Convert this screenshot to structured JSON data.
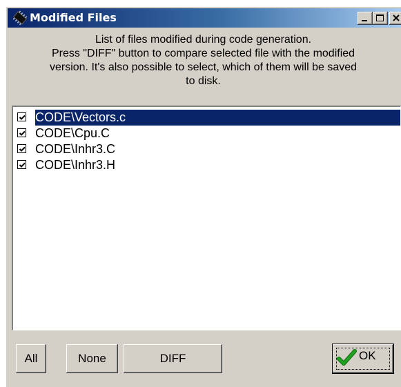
{
  "window": {
    "title": "Modified Files",
    "title_icon": "chip-icon",
    "caption_buttons": [
      "minimize",
      "maximize",
      "close"
    ]
  },
  "description": {
    "lines": [
      "List of files modified during code generation.",
      "Press \"DIFF\" button to compare selected file with the modified",
      "version. It's also possible to select, which of them will be saved",
      "to disk."
    ]
  },
  "files": {
    "items": [
      {
        "label": "CODE\\Vectors.c",
        "checked": true,
        "selected": true
      },
      {
        "label": "CODE\\Cpu.C",
        "checked": true,
        "selected": false
      },
      {
        "label": "CODE\\Inhr3.C",
        "checked": true,
        "selected": false
      },
      {
        "label": "CODE\\Inhr3.H",
        "checked": true,
        "selected": false
      }
    ]
  },
  "buttons": {
    "all": "All",
    "none": "None",
    "diff": "DIFF",
    "ok": "OK",
    "ok_icon": "green-check-icon"
  },
  "colors": {
    "titlebar_start": "#0a246a",
    "titlebar_end": "#a6caf0",
    "selection": "#0a246a",
    "face": "#d4d0c8",
    "ok_check": "#22a022"
  }
}
